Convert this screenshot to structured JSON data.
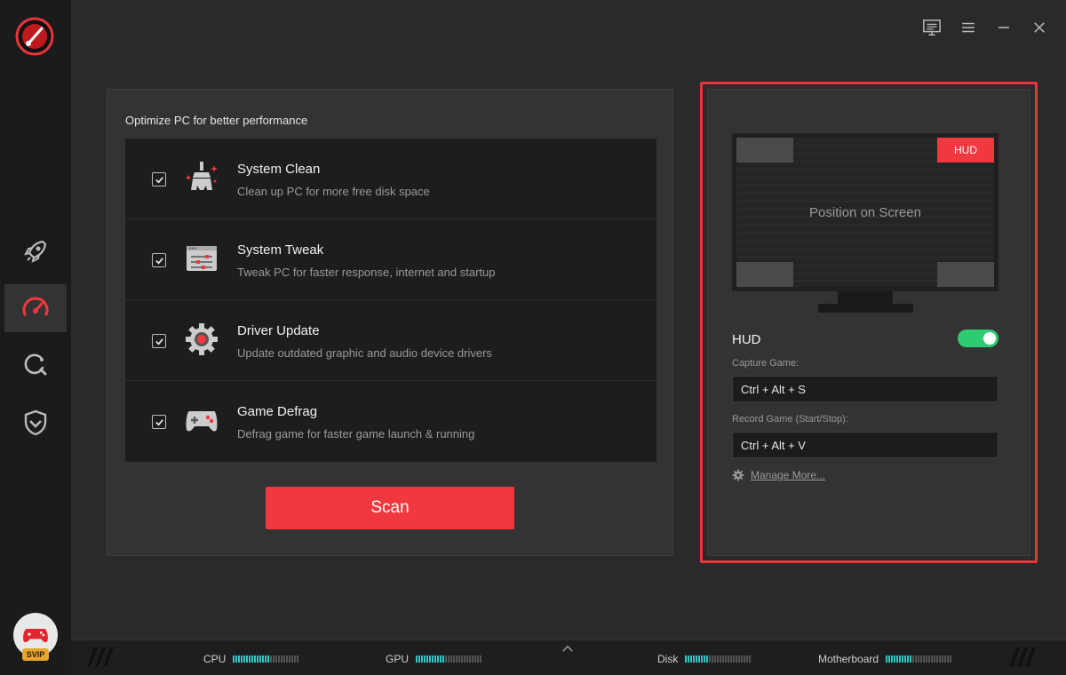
{
  "sidebar": {
    "items": [
      {
        "id": "boost",
        "icon": "rocket-icon"
      },
      {
        "id": "speedup",
        "icon": "speedometer-icon",
        "active": true
      },
      {
        "id": "search",
        "icon": "search-refresh-icon"
      },
      {
        "id": "security",
        "icon": "shield-icon"
      }
    ],
    "badge": "SVIP"
  },
  "optimize": {
    "title": "Optimize PC for better performance",
    "items": [
      {
        "title": "System Clean",
        "desc": "Clean up PC for more free disk space",
        "checked": true,
        "icon": "broom-icon"
      },
      {
        "title": "System Tweak",
        "desc": "Tweak PC for faster response, internet and startup",
        "checked": true,
        "icon": "sliders-icon"
      },
      {
        "title": "Driver Update",
        "desc": "Update outdated graphic and audio device drivers",
        "checked": true,
        "icon": "gear-icon"
      },
      {
        "title": "Game Defrag",
        "desc": "Defrag game for faster game launch & running",
        "checked": true,
        "icon": "gamepad-icon"
      }
    ],
    "scan_label": "Scan"
  },
  "hud": {
    "tag": "HUD",
    "monitor_text": "Position on Screen",
    "label": "HUD",
    "enabled": true,
    "capture_label": "Capture Game:",
    "capture_value": "Ctrl + Alt + S",
    "record_label": "Record Game (Start/Stop):",
    "record_value": "Ctrl + Alt + V",
    "manage_label": "Manage More..."
  },
  "status": {
    "cpu": {
      "label": "CPU",
      "level": 0.55
    },
    "gpu": {
      "label": "GPU",
      "level": 0.45
    },
    "disk": {
      "label": "Disk",
      "level": 0.35
    },
    "motherboard": {
      "label": "Motherboard",
      "level": 0.4
    }
  },
  "colors": {
    "accent": "#f2383f",
    "toggle_on": "#2ecc71",
    "meter": "#2ec6c6"
  }
}
